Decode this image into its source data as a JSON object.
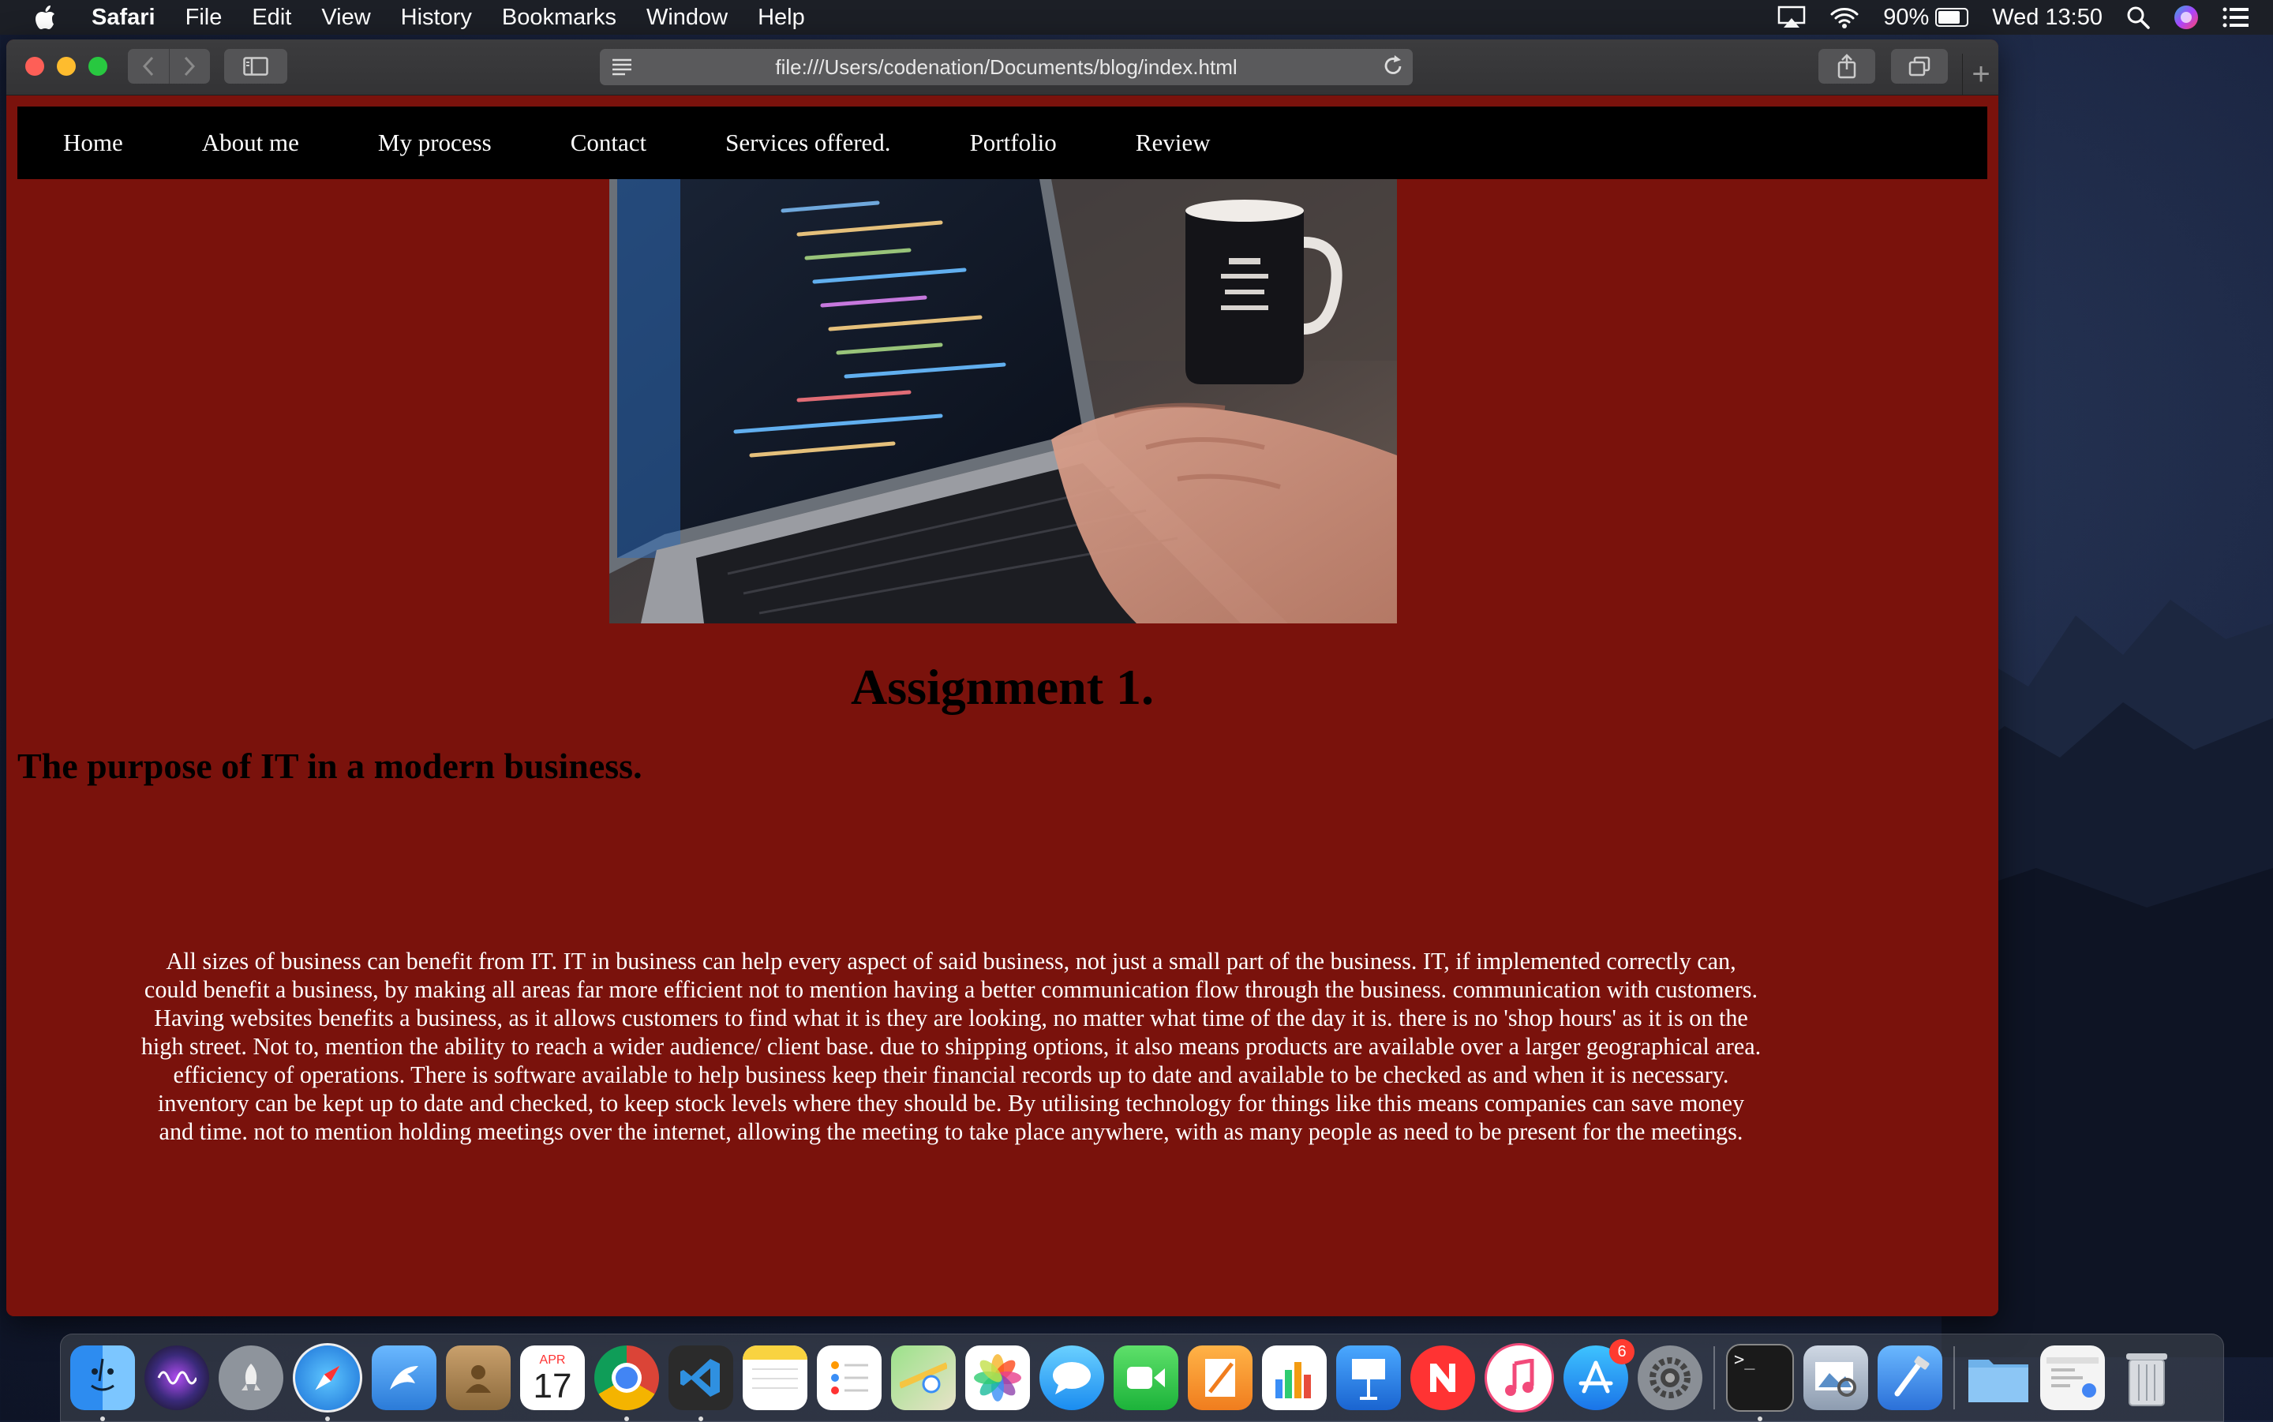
{
  "menubar": {
    "app_name": "Safari",
    "menus": [
      "File",
      "Edit",
      "View",
      "History",
      "Bookmarks",
      "Window",
      "Help"
    ],
    "battery_text": "90%",
    "battery_level": 0.9,
    "clock": "Wed 13:50"
  },
  "browser": {
    "url": "file:///Users/codenation/Documents/blog/index.html"
  },
  "nav": {
    "items": [
      "Home",
      "About me",
      "My process",
      "Contact",
      "Services offered.",
      "Portfolio",
      "Review"
    ]
  },
  "page": {
    "title": "Assignment 1.",
    "subtitle": "The purpose of IT in a modern business.",
    "body": "All sizes of business can benefit from IT. IT in business can help every aspect of said business, not just a small part of the business. IT, if implemented correctly can, could benefit a business, by making all areas far more efficient not to mention having a better communication flow through the business. communication with customers. Having websites benefits a business, as it allows customers to find what it is they are looking, no matter what time of the day it is. there is no 'shop hours' as it is on the high street. Not to, mention the ability to reach a wider audience/ client base. due to shipping options, it also means products are available over a larger geographical area. efficiency of operations. There is software available to help business keep their financial records up to date and available to be checked as and when it is necessary. inventory can be kept up to date and checked, to keep stock levels where they should be. By utilising technology for things like this means companies can save money and time. not to mention holding meetings over the internet, allowing the meeting to take place anywhere, with as many people as need to be present for the meetings."
  },
  "dock": {
    "calendar_month": "APR",
    "calendar_day": "17",
    "app_store_badge": "6",
    "apps": [
      "finder-icon",
      "siri-icon",
      "launchpad-icon",
      "safari-icon",
      "mail-icon",
      "contacts-icon",
      "calendar-icon",
      "chrome-icon",
      "vscode-icon",
      "notes-icon",
      "reminders-icon",
      "maps-icon",
      "photos-icon",
      "messages-icon",
      "facetime-icon",
      "pages-icon",
      "numbers-icon",
      "keynote-icon",
      "news-icon",
      "music-icon",
      "app-store-icon",
      "system-preferences-icon",
      "terminal-icon",
      "preview-icon",
      "xcode-icon",
      "downloads-folder-icon",
      "recent-window-icon",
      "trash-icon"
    ]
  }
}
